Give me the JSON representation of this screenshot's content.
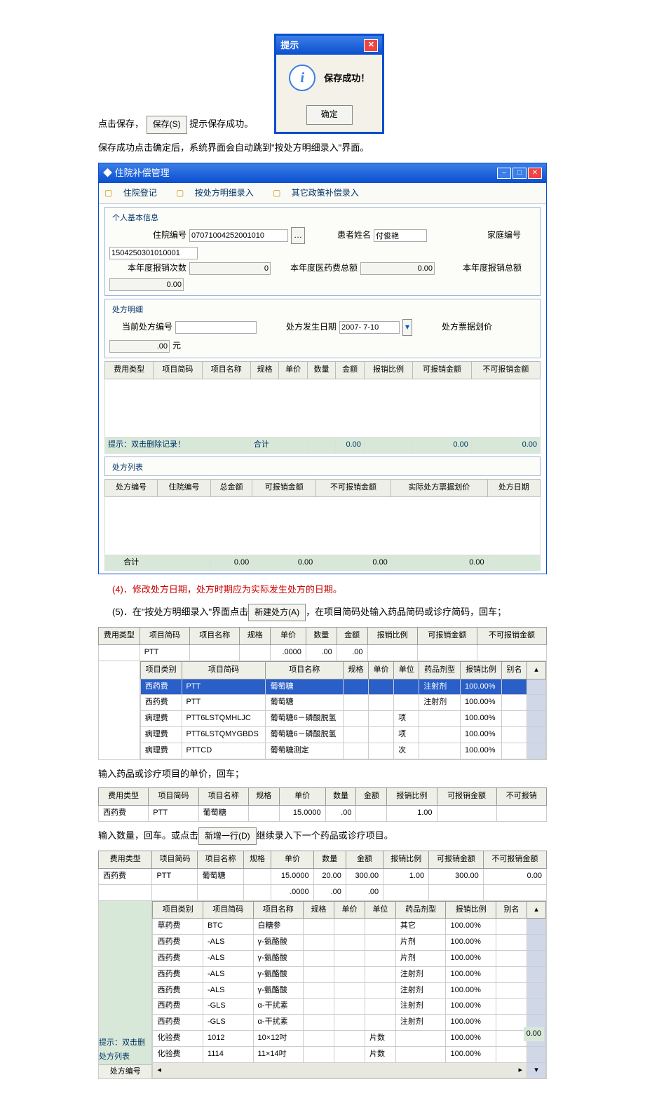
{
  "para1_a": "点击保存，",
  "save_btn": "保存(S)",
  "para1_b": "提示保存成功。",
  "dialog": {
    "title": "提示",
    "msg": "保存成功！",
    "ok": "确定"
  },
  "para2": "保存成功点击确定后，系统界面会自动跳到\"按处方明细录入\"界面。",
  "app": {
    "title": "◆ 住院补偿管理",
    "tabs": {
      "t1": "住院登记",
      "t2": "按处方明细录入",
      "t3": "其它政策补偿录入"
    },
    "grp1": {
      "legend": "个人基本信息",
      "f1": {
        "l": "住院编号",
        "v": "07071004252001010"
      },
      "f2": {
        "l": "患者姓名",
        "v": "付俊艳"
      },
      "f3": {
        "l": "家庭编号",
        "v": "1504250301010001"
      },
      "f4": {
        "l": "本年度报销次数",
        "v": "0"
      },
      "f5": {
        "l": "本年度医药费总额",
        "v": "0.00"
      },
      "f6": {
        "l": "本年度报销总额",
        "v": "0.00"
      }
    },
    "grp2": {
      "legend": "处方明细",
      "f1": {
        "l": "当前处方编号",
        "v": ""
      },
      "f2": {
        "l": "处方发生日期",
        "v": "2007- 7-10"
      },
      "f3": {
        "l": "处方票据划价",
        "v": ".00",
        "unit": "元"
      }
    },
    "cols1": [
      "费用类型",
      "项目简码",
      "项目名称",
      "规格",
      "单价",
      "数量",
      "金额",
      "报销比例",
      "可报销金额",
      "不可报销金额"
    ],
    "hint": "提示：双击删除记录！",
    "sum": "合计",
    "z": "0.00",
    "grp3": {
      "legend": "处方列表"
    },
    "cols2": [
      "处方编号",
      "住院编号",
      "总金额",
      "可报销金额",
      "不可报销金额",
      "实际处方票据划价",
      "处方日期"
    ]
  },
  "para4": "(4)．修改处方日期，处方时期应为实际发生处方的日期。",
  "para5a": "(5)．在\"按处方明细录入\"界面点击",
  "newrx_btn": "新建处方(A)",
  "para5b": "，在项目简码处输入药品简码或诊疗简码，回车；",
  "tblA": {
    "head": [
      "费用类型",
      "项目简码",
      "项目名称",
      "规格",
      "单价",
      "数量",
      "金额",
      "报销比例",
      "可报销金额",
      "不可报销金额"
    ],
    "r1": {
      "code": "PTT",
      "price": ".0000",
      "qty": ".00",
      "amt": ".00"
    },
    "sub_head": [
      "项目类别",
      "项目简码",
      "项目名称",
      "规格",
      "单价",
      "单位",
      "药品剂型",
      "报销比例",
      "别名"
    ],
    "rows": [
      {
        "cat": "西药费",
        "code": "PTT",
        "name": "葡萄糖",
        "unit": "",
        "form": "注射剂",
        "rate": "100.00%",
        "hi": true
      },
      {
        "cat": "西药费",
        "code": "PTT",
        "name": "葡萄糖",
        "unit": "",
        "form": "注射剂",
        "rate": "100.00%"
      },
      {
        "cat": "病理费",
        "code": "PTT6LSTQMHLJC",
        "name": "葡萄糖6－磷酸脱氢",
        "unit": "项",
        "form": "",
        "rate": "100.00%"
      },
      {
        "cat": "病理费",
        "code": "PTT6LSTQMYGBDS",
        "name": "葡萄糖6－磷酸脱氢",
        "unit": "项",
        "form": "",
        "rate": "100.00%"
      },
      {
        "cat": "病理费",
        "code": "PTTCD",
        "name": "葡萄糖测定",
        "unit": "次",
        "form": "",
        "rate": "100.00%"
      }
    ]
  },
  "para6": "输入药品或诊疗项目的单价，回车；",
  "tblB": {
    "head": [
      "费用类型",
      "项目简码",
      "项目名称",
      "规格",
      "单价",
      "数量",
      "金额",
      "报销比例",
      "可报销金额",
      "不可报销"
    ],
    "r": {
      "cat": "西药费",
      "code": "PTT",
      "name": "葡萄糖",
      "price": "15.0000",
      "qty": ".00",
      "rate": "1.00"
    }
  },
  "para7a": "输入数量，回车。或点击",
  "addrow_btn": "新增一行(D)",
  "para7b": "继续录入下一个药品或诊疗项目。",
  "tblC": {
    "head": [
      "费用类型",
      "项目简码",
      "项目名称",
      "规格",
      "单价",
      "数量",
      "金额",
      "报销比例",
      "可报销金额",
      "不可报销金额"
    ],
    "r1": {
      "cat": "西药费",
      "code": "PTT",
      "name": "葡萄糖",
      "price": "15.0000",
      "qty": "20.00",
      "amt": "300.00",
      "rate": "1.00",
      "ok": "300.00",
      "no": "0.00"
    },
    "r2": {
      "price": ".0000",
      "qty": ".00",
      "amt": ".00"
    },
    "sub_head": [
      "项目类别",
      "项目简码",
      "项目名称",
      "规格",
      "单价",
      "单位",
      "药品剂型",
      "报销比例",
      "别名"
    ],
    "rows": [
      {
        "cat": "草药费",
        "code": "BTC",
        "name": "白糖参",
        "unit": "",
        "form": "其它",
        "rate": "100.00%"
      },
      {
        "cat": "西药费",
        "code": "-ALS",
        "name": "γ-氨酪酸",
        "unit": "",
        "form": "片剂",
        "rate": "100.00%"
      },
      {
        "cat": "西药费",
        "code": "-ALS",
        "name": "γ-氨酪酸",
        "unit": "",
        "form": "片剂",
        "rate": "100.00%"
      },
      {
        "cat": "西药费",
        "code": "-ALS",
        "name": "γ-氨酪酸",
        "unit": "",
        "form": "注射剂",
        "rate": "100.00%"
      },
      {
        "cat": "西药费",
        "code": "-ALS",
        "name": "γ-氨酪酸",
        "unit": "",
        "form": "注射剂",
        "rate": "100.00%"
      },
      {
        "cat": "西药费",
        "code": "-GLS",
        "name": "α-干扰素",
        "unit": "",
        "form": "注射剂",
        "rate": "100.00%"
      },
      {
        "cat": "西药费",
        "code": "-GLS",
        "name": "α-干扰素",
        "unit": "",
        "form": "注射剂",
        "rate": "100.00%"
      },
      {
        "cat": "化验费",
        "code": "1012",
        "name": "10×12吋",
        "unit": "片数",
        "form": "",
        "rate": "100.00%"
      },
      {
        "cat": "化验费",
        "code": "1114",
        "name": "11×14吋",
        "unit": "片数",
        "form": "",
        "rate": "100.00%"
      }
    ],
    "left_hint": "提示：双击删",
    "left_l1": "处方列表",
    "left_l2": "处方编号",
    "right_val": "0.00"
  }
}
